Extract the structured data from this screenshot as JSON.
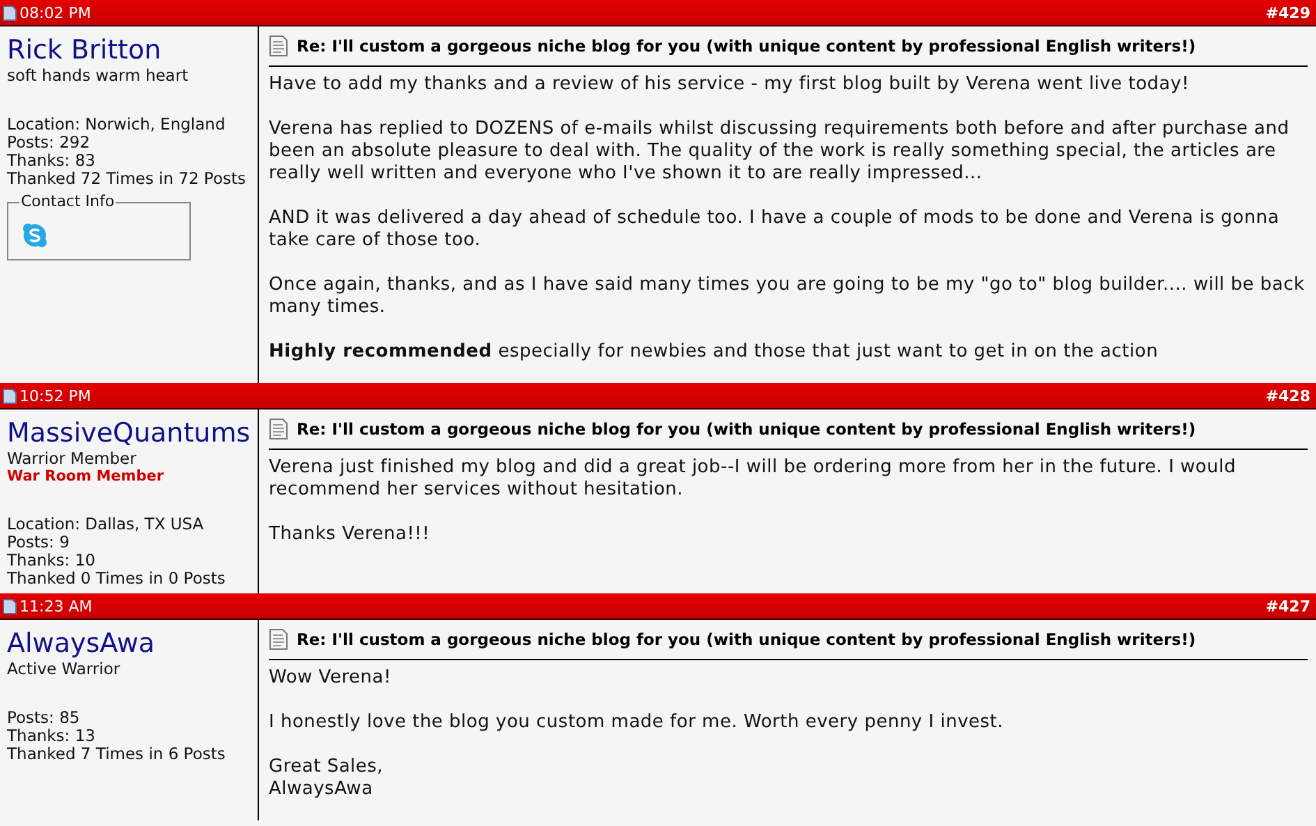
{
  "posts": [
    {
      "time": "08:02 PM",
      "number": "#429",
      "user": {
        "name": "Rick Britton",
        "title": "soft hands warm heart",
        "stats": [
          "Location: Norwich, England",
          "Posts: 292",
          "Thanks: 83",
          "Thanked 72 Times in 72 Posts"
        ],
        "contact": {
          "legend": "Contact Info"
        }
      },
      "subject": "Re: I'll custom a gorgeous niche blog for you (with unique content by professional English writers!)",
      "paragraphs": [
        "Have to add my thanks and a review of his service - my first blog built by Verena went live today!",
        "Verena has replied to DOZENS of e-mails whilst discussing requirements both before and after purchase and been an absolute pleasure to deal with. The quality of the work is really something special, the articles are really well written and everyone who I've shown it to are really impressed...",
        "AND it was delivered a day ahead of schedule too. I have a couple of mods to be done and Verena is gonna take care of those too.",
        "Once again, thanks, and as I have said many times you are going to be my \"go to\" blog builder.... will be back many times.",
        "**Highly recommended** especially for newbies and those that just want to get in on the action"
      ]
    },
    {
      "time": "10:52 PM",
      "number": "#428",
      "user": {
        "name": "MassiveQuantums",
        "title": "Warrior Member",
        "badge": "War Room Member",
        "stats": [
          "Location: Dallas, TX USA",
          "Posts: 9",
          "Thanks: 10",
          "Thanked 0 Times in 0 Posts"
        ]
      },
      "subject": "Re: I'll custom a gorgeous niche blog for you (with unique content by professional English writers!)",
      "paragraphs": [
        "Verena just finished my blog and did a great job--I will be ordering more from her in the future. I would recommend her services without hesitation.",
        "Thanks Verena!!!"
      ]
    },
    {
      "time": "11:23 AM",
      "number": "#427",
      "user": {
        "name": "AlwaysAwa",
        "title": "Active Warrior",
        "stats": [
          "Posts: 85",
          "Thanks: 13",
          "Thanked 7 Times in 6 Posts"
        ]
      },
      "subject": "Re: I'll custom a gorgeous niche blog for you (with unique content by professional English writers!)",
      "paragraphs": [
        "Wow Verena!",
        "I honestly love the blog you custom made for me. Worth every penny I invest.",
        "Great Sales,\nAlwaysAwa"
      ]
    }
  ]
}
